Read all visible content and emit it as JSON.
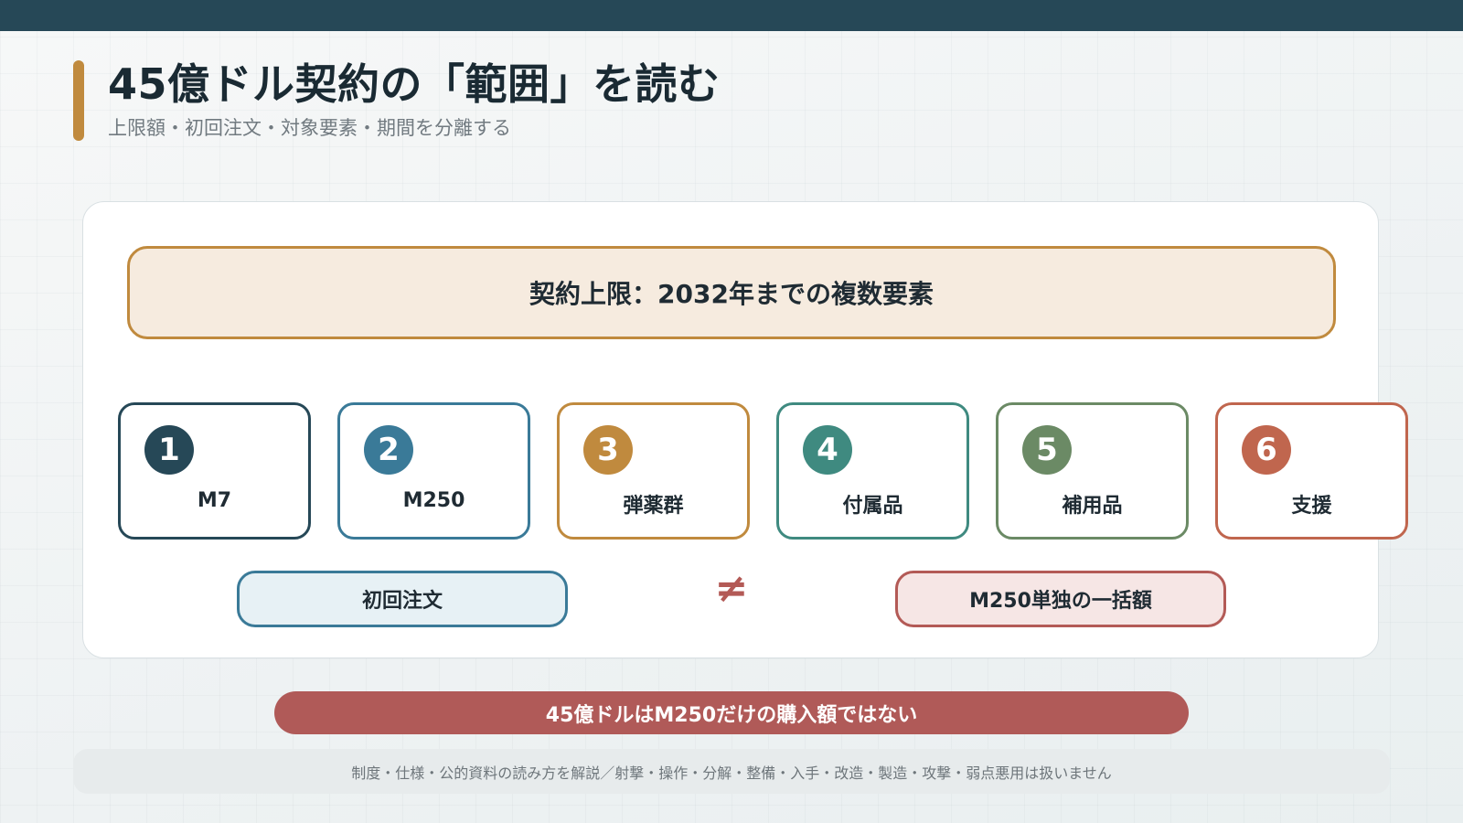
{
  "header": {
    "title": "45億ドル契約の「範囲」を読む",
    "subtitle": "上限額・初回注文・対象要素・期間を分離する"
  },
  "scope": {
    "label": "契約上限：2032年までの複数要素"
  },
  "elements": [
    {
      "number": "1",
      "label": "M7",
      "color": "#264857"
    },
    {
      "number": "2",
      "label": "M250",
      "color": "#3a7a98"
    },
    {
      "number": "3",
      "label": "弾薬群",
      "color": "#c08a3e"
    },
    {
      "number": "4",
      "label": "付属品",
      "color": "#3f8a80"
    },
    {
      "number": "5",
      "label": "補用品",
      "color": "#6b8a65"
    },
    {
      "number": "6",
      "label": "支援",
      "color": "#c0664e"
    }
  ],
  "comparison": {
    "left": "初回注文",
    "symbol": "≠",
    "right": "M250単独の一括額"
  },
  "conclusion": "45億ドルはM250だけの購入額ではない",
  "footer": "制度・仕様・公的資料の読み方を解説／射撃・操作・分解・整備・入手・改造・製造・攻撃・弱点悪用は扱いません"
}
